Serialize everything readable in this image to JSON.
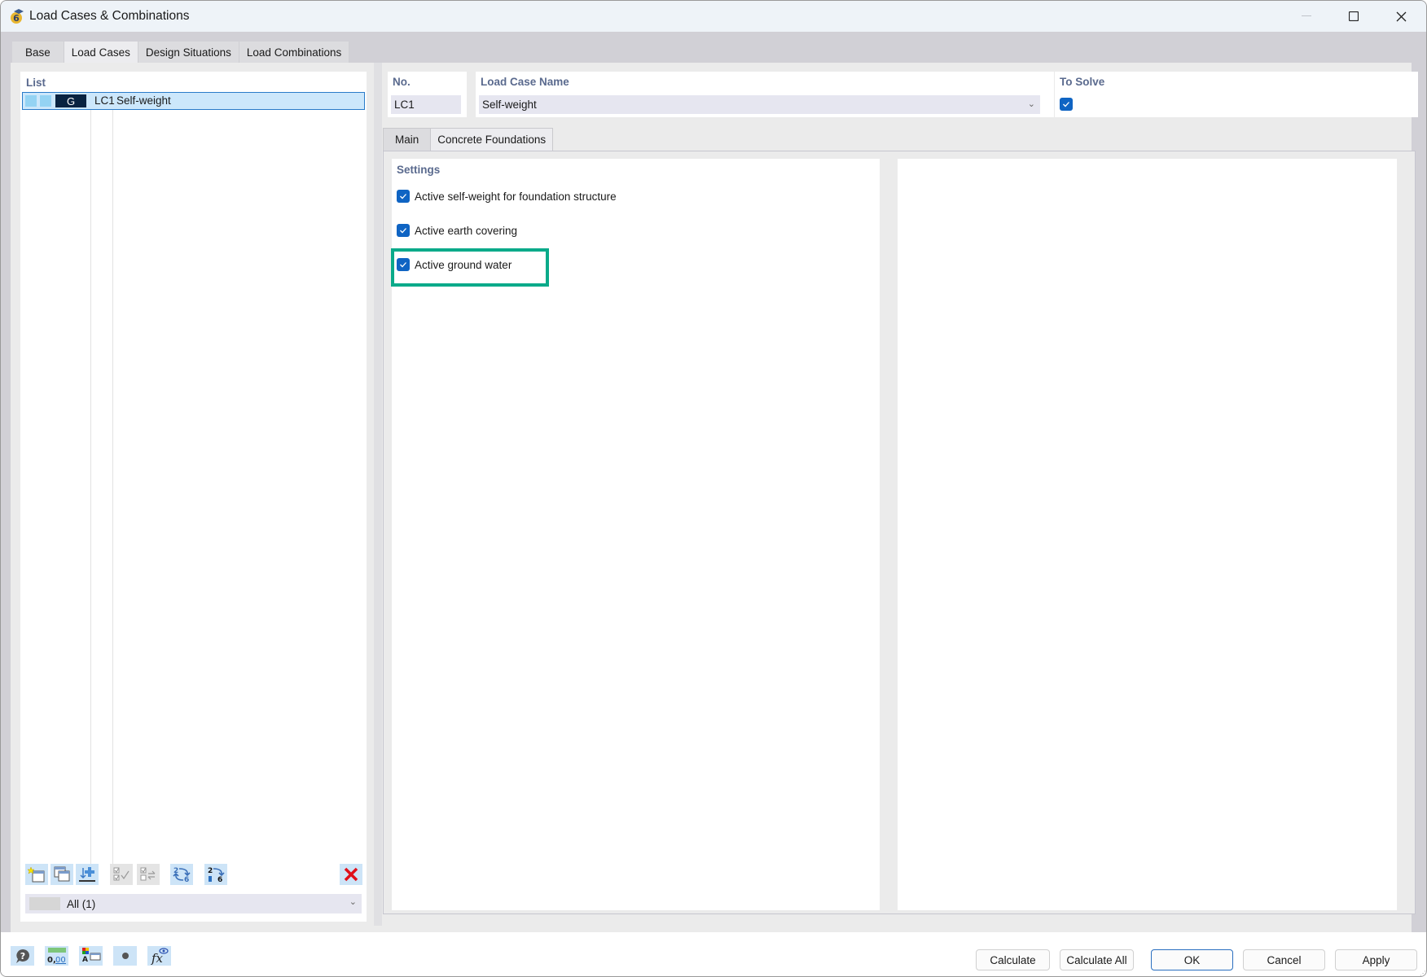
{
  "window": {
    "title": "Load Cases & Combinations",
    "controls": {
      "minimize": "—",
      "maximize": "☐",
      "close": "✕"
    }
  },
  "top_tabs": [
    {
      "label": "Base",
      "active": false
    },
    {
      "label": "Load Cases",
      "active": true
    },
    {
      "label": "Design Situations",
      "active": false
    },
    {
      "label": "Load Combinations",
      "active": false
    }
  ],
  "list": {
    "label": "List",
    "items": [
      {
        "category": "G",
        "no": "LC1",
        "name": "Self-weight",
        "selected": true
      }
    ],
    "toolbar": [
      {
        "name": "new-item-icon",
        "enabled": true
      },
      {
        "name": "copy-item-icon",
        "enabled": true
      },
      {
        "name": "import-item-icon",
        "enabled": true
      },
      {
        "name": "check-all-icon",
        "enabled": false
      },
      {
        "name": "toggle-check-icon",
        "enabled": false
      },
      {
        "name": "renumber-icon",
        "enabled": true
      },
      {
        "name": "renumber-sequential-icon",
        "enabled": true
      },
      {
        "name": "delete-icon",
        "enabled": true
      }
    ],
    "filter": {
      "value": "All (1)"
    }
  },
  "header": {
    "no_label": "No.",
    "no_value": "LC1",
    "name_label": "Load Case Name",
    "name_value": "Self-weight",
    "to_solve_label": "To Solve",
    "to_solve_checked": true
  },
  "sub_tabs": [
    {
      "label": "Main",
      "active": false
    },
    {
      "label": "Concrete Foundations",
      "active": true
    }
  ],
  "settings": {
    "label": "Settings",
    "options": [
      {
        "label": "Active self-weight for foundation structure",
        "checked": true
      },
      {
        "label": "Active earth covering",
        "checked": true
      },
      {
        "label": "Active ground water",
        "checked": true,
        "highlighted": true
      }
    ],
    "highlight_color": "#0aaa8a"
  },
  "bottom_icons": [
    {
      "name": "help-icon"
    },
    {
      "name": "units-icon",
      "text": "0,00"
    },
    {
      "name": "display-settings-icon"
    },
    {
      "name": "dot-icon"
    },
    {
      "name": "formula-icon",
      "text": "fx"
    }
  ],
  "buttons": {
    "calculate": "Calculate",
    "calculate_all": "Calculate All",
    "ok": "OK",
    "cancel": "Cancel",
    "apply": "Apply"
  },
  "colors": {
    "accent": "#0f64c3",
    "selection": "#cce7fb",
    "label": "#5a6a8e",
    "category_bg": "#082341"
  }
}
